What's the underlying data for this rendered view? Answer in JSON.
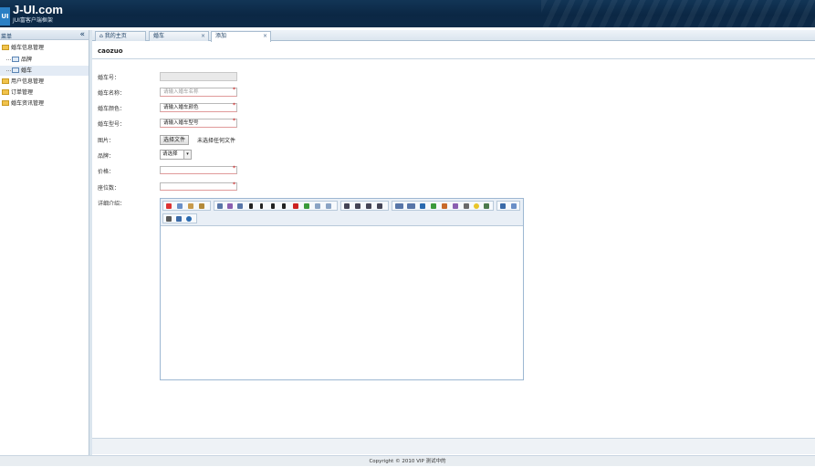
{
  "header": {
    "logo_mark": "UI",
    "logo_title": "J-UI.com",
    "logo_subtitle": "JUI富客户端框架"
  },
  "sidebar": {
    "title": "菜单",
    "collapse_icon": "«",
    "items": [
      {
        "label": "婚车信息管理"
      },
      {
        "label": "品牌"
      },
      {
        "label": "婚车"
      },
      {
        "label": "用户信息管理"
      },
      {
        "label": "订单管理"
      },
      {
        "label": "婚车资讯管理"
      }
    ]
  },
  "tabs": [
    {
      "label": "我的主页"
    },
    {
      "label": "婚车"
    },
    {
      "label": "添加"
    }
  ],
  "form": {
    "title": "caozuo",
    "fields": {
      "car_no": {
        "label": "婚车号："
      },
      "car_name": {
        "label": "婚车名称：",
        "placeholder": "请输入婚车名称"
      },
      "car_color": {
        "label": "婚车颜色：",
        "placeholder": "请输入婚车颜色"
      },
      "car_model": {
        "label": "婚车型号：",
        "placeholder": "请输入婚车型号"
      },
      "image": {
        "label": "图片：",
        "button": "选择文件",
        "status": "未选择任何文件"
      },
      "brand": {
        "label": "品牌：",
        "value": "请选择"
      },
      "price": {
        "label": "价格："
      },
      "seats": {
        "label": "座位数："
      },
      "description": {
        "label": "详细介绍："
      }
    },
    "required_mark": "*"
  },
  "footer": {
    "text": "Copyright © 2010 VIP 测试中的"
  },
  "colors": {
    "header_bg": "#0b2744",
    "accent": "#2a7fc4",
    "required": "#d01010"
  }
}
